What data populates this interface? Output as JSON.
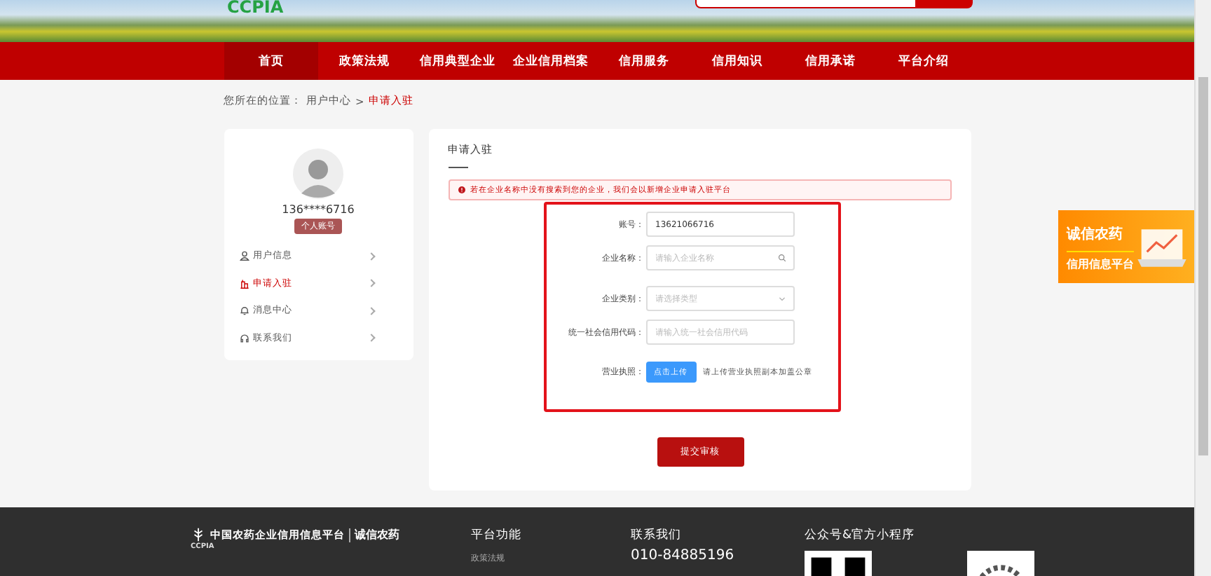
{
  "header": {
    "logo": "CCPIA"
  },
  "nav": [
    {
      "label": "首页",
      "selected": true
    },
    {
      "label": "政策法规",
      "selected": false
    },
    {
      "label": "信用典型企业",
      "selected": false
    },
    {
      "label": "企业信用档案",
      "selected": false
    },
    {
      "label": "信用服务",
      "selected": false
    },
    {
      "label": "信用知识",
      "selected": false
    },
    {
      "label": "信用承诺",
      "selected": false
    },
    {
      "label": "平台介绍",
      "selected": false
    }
  ],
  "breadcrumb": {
    "prefix": "您所在的位置：",
    "items": [
      "用户中心",
      "申请入驻"
    ],
    "separator": ">"
  },
  "sidebar": {
    "phone": "136****6716",
    "badge": "个人账号",
    "items": [
      {
        "label": "用户信息",
        "selected": false
      },
      {
        "label": "申请入驻",
        "selected": true
      },
      {
        "label": "消息中心",
        "selected": false
      },
      {
        "label": "联系我们",
        "selected": false
      }
    ]
  },
  "form": {
    "title": "申请入驻",
    "alert": "若在企业名称中没有搜索到您的企业，我们会以新增企业申请入驻平台",
    "fields": [
      {
        "kind": "text",
        "label": "账号：",
        "value": "13621066716"
      },
      {
        "kind": "search",
        "label": "企业名称：",
        "placeholder": "请输入企业名称"
      },
      {
        "kind": "select",
        "label": "企业类别：",
        "placeholder": "请选择类型"
      },
      {
        "kind": "text",
        "label": "统一社会信用代码：",
        "placeholder": "请输入统一社会信用代码"
      },
      {
        "kind": "upload",
        "label": "营业执照：",
        "button": "点击上传",
        "hint": "请上传营业执照副本加盖公章"
      }
    ],
    "submit": "提交审核"
  },
  "ad": {
    "title": "诚信农药",
    "subtitle": "信用信息平台"
  },
  "footer": {
    "logo_cn": "中国农药企业信用信息平台",
    "logo_en": "CCPIA",
    "brand": "诚信农药",
    "columns": [
      {
        "title": "平台功能",
        "lines": [
          "政策法规"
        ]
      },
      {
        "title": "联系我们",
        "lines": [
          "010-84885196"
        ]
      },
      {
        "title": "公众号&官方小程序"
      }
    ]
  }
}
